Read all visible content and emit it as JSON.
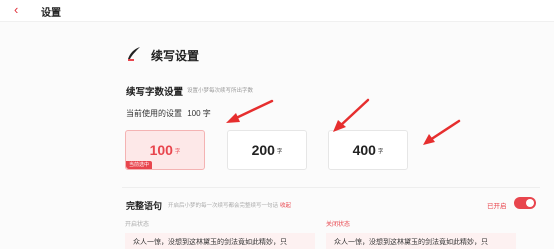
{
  "header": {
    "back_icon": "‹",
    "title": "设置"
  },
  "section": {
    "title": "续写设置"
  },
  "word_count": {
    "title": "续写字数设置",
    "subtitle": "设置小梦每次续写所出字数",
    "current_prefix": "当前使用的设置",
    "current_value": "100 字",
    "options": [
      {
        "value": "100",
        "unit": "字",
        "selected": true,
        "badge": "当前选中"
      },
      {
        "value": "200",
        "unit": "字",
        "selected": false
      },
      {
        "value": "400",
        "unit": "字",
        "selected": false
      }
    ]
  },
  "complete_sentence": {
    "title": "完整语句",
    "subtitle": "开启后小梦的每一次续写都会完整续写一句话",
    "link": "收起",
    "toggle_label": "已开启",
    "toggle_on": true,
    "state_on_label": "开启状态",
    "state_off_label": "关闭状态",
    "sample_on": "众人一惊，没想到这林黛玉的剑法竟如此精妙，只",
    "sample_off": "众人一惊，没想到这林黛玉的剑法竟如此精妙，只"
  },
  "colors": {
    "accent": "#e8454d"
  },
  "icons": {
    "back": "chevron-left-icon",
    "header": "quill-icon"
  }
}
